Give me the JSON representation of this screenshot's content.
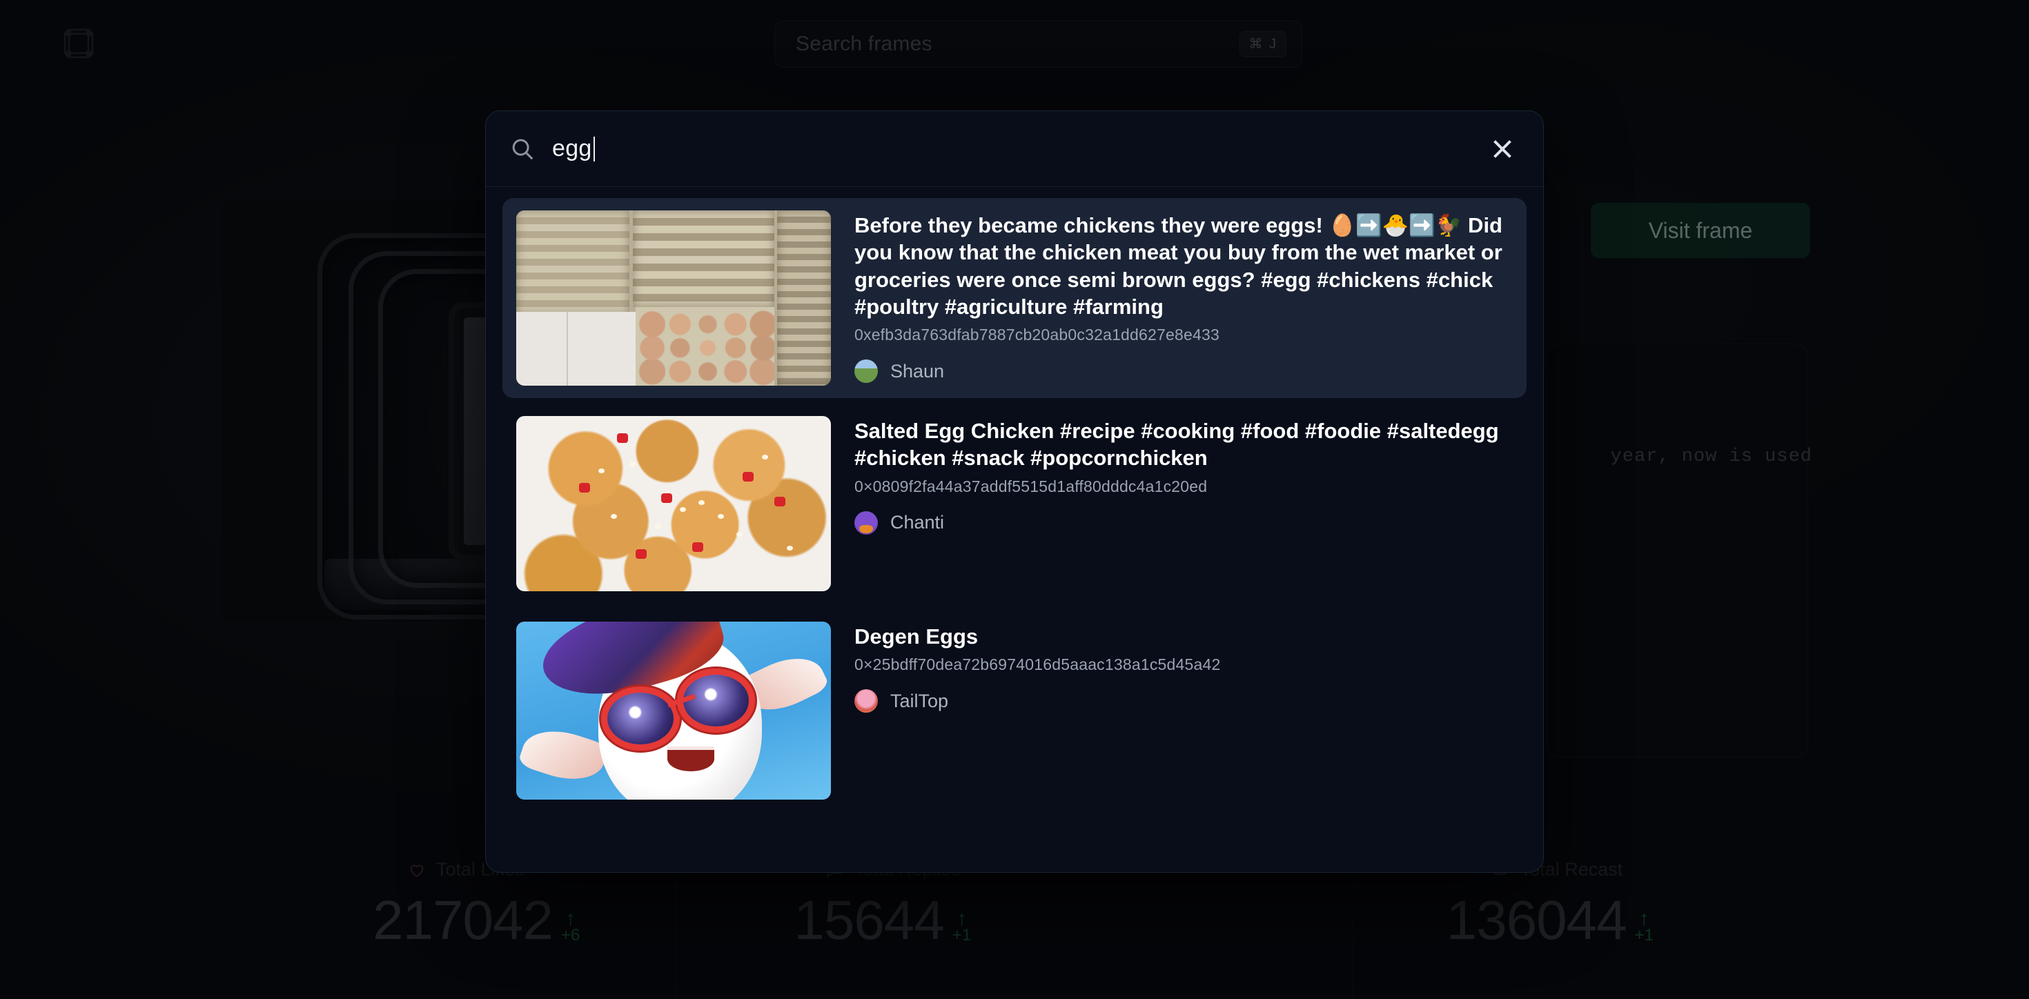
{
  "app": {
    "logo_name": "pixel-frame-logo",
    "background_color": "#070809"
  },
  "topbar": {
    "search_placeholder": "Search frames",
    "search_shortcut": "⌘ J",
    "search_icon": "search-icon"
  },
  "hero": {
    "visit_frame_label": "Visit frame",
    "description_snippet": "year, now is used"
  },
  "stats": [
    {
      "icon": "heart-icon",
      "label": "Total Likes",
      "value": "217042",
      "delta": "+6",
      "delta_arrow": "↑",
      "delta_color": "#1f6b3e"
    },
    {
      "icon": "comment-icon",
      "label": "Total Replies",
      "value": "15644",
      "delta": "+1",
      "delta_arrow": "↑",
      "delta_color": "#1f6b3e"
    },
    {
      "icon": "recast-icon",
      "label": "Total Recast",
      "value": "136044",
      "delta": "+1",
      "delta_arrow": "↑",
      "delta_color": "#1f6b3e"
    }
  ],
  "search_modal": {
    "search_icon": "search-icon",
    "query": "egg",
    "close_icon": "close-icon",
    "panel_color": "#080d19",
    "selected_row_color": "#1b2436",
    "results": [
      {
        "thumbnail": "egg-trays-photo",
        "title": "Before they became chickens they were eggs! 🥚➡️🐣➡️🐓 Did you know that the chicken meat you buy from the wet market or groceries were once semi brown eggs? #egg #chickens #chick #poultry #agriculture #farming",
        "hash": "0xefb3da763dfab7887cb20ab0c32a1dd627e8e433",
        "author": "Shaun",
        "author_avatar": "shaun-avatar",
        "selected": true
      },
      {
        "thumbnail": "salted-egg-chicken-photo",
        "title": "Salted Egg Chicken #recipe #cooking #food #foodie #saltedegg #chicken #snack #popcornchicken",
        "hash": "0×0809f2fa44a37addf5515d1aff80dddc4a1c20ed",
        "author": "Chanti",
        "author_avatar": "chanti-avatar",
        "selected": false
      },
      {
        "thumbnail": "degen-eggs-character-art",
        "title": "Degen Eggs",
        "hash": "0×25bdff70dea72b6974016d5aaac138a1c5d45a42",
        "author": "TailTop",
        "author_avatar": "tailtop-avatar",
        "selected": false
      }
    ]
  }
}
